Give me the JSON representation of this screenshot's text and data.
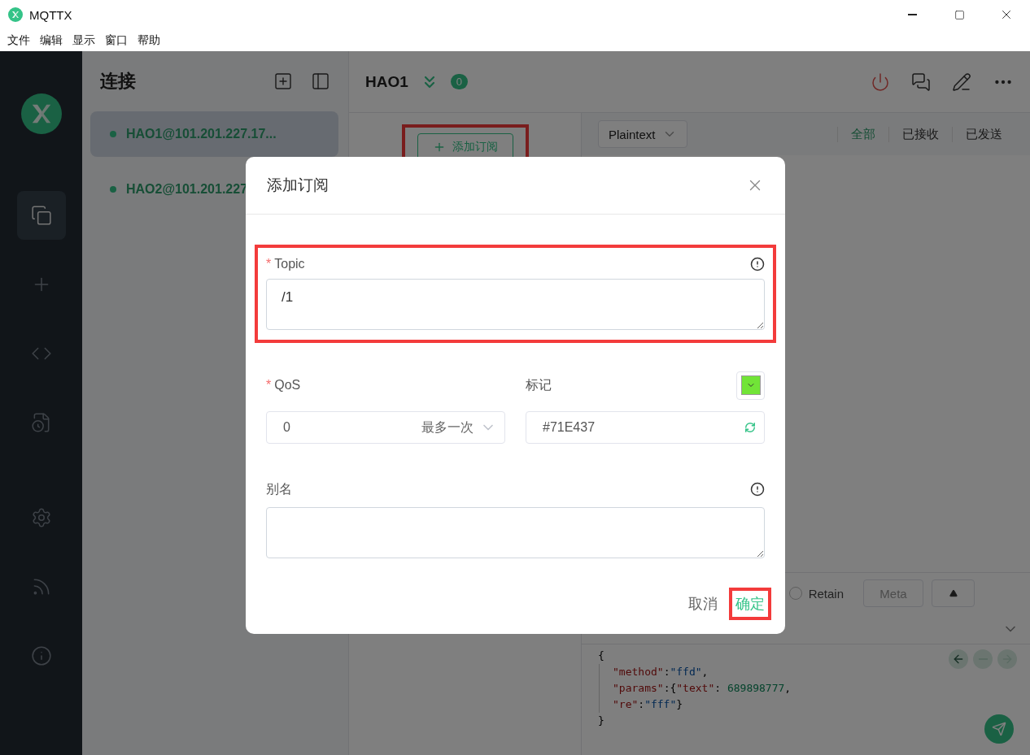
{
  "window": {
    "title": "MQTTX"
  },
  "menu": [
    "文件",
    "编辑",
    "显示",
    "窗口",
    "帮助"
  ],
  "nav": [
    {
      "kind": "connections",
      "selected": true
    },
    {
      "kind": "new",
      "selected": false
    },
    {
      "kind": "script",
      "selected": false
    },
    {
      "kind": "log",
      "selected": false
    },
    {
      "kind": "settings",
      "selected": false
    },
    {
      "kind": "feed",
      "selected": false
    },
    {
      "kind": "about",
      "selected": false
    }
  ],
  "connections": {
    "title": "连接",
    "items": [
      {
        "name": "HAO1@101.201.227.17...",
        "selected": true
      },
      {
        "name": "HAO2@101.201.227",
        "selected": false
      }
    ]
  },
  "header": {
    "title": "HAO1",
    "badge": "0"
  },
  "add_subscription": {
    "label": "添加订阅"
  },
  "format": {
    "value": "Plaintext"
  },
  "filter_tabs": [
    {
      "label": "全部",
      "selected": true
    },
    {
      "label": "已接收",
      "selected": false
    },
    {
      "label": "已发送",
      "selected": false
    }
  ],
  "composer": {
    "retain": {
      "label": "Retain",
      "checked": false
    },
    "meta": "Meta",
    "code_lines": [
      {
        "indented": false,
        "tokens": [
          {
            "kind": "punct",
            "text": "{"
          }
        ]
      },
      {
        "indented": true,
        "tokens": [
          {
            "kind": "key",
            "text": "\"method\""
          },
          {
            "kind": "punct",
            "text": ":"
          },
          {
            "kind": "string",
            "text": "\"ffd\""
          },
          {
            "kind": "punct",
            "text": ","
          }
        ]
      },
      {
        "indented": true,
        "tokens": [
          {
            "kind": "key",
            "text": "\"params\""
          },
          {
            "kind": "punct",
            "text": ":{"
          },
          {
            "kind": "key",
            "text": "\"text\""
          },
          {
            "kind": "punct",
            "text": ": "
          },
          {
            "kind": "number",
            "text": "689898777"
          },
          {
            "kind": "punct",
            "text": ","
          }
        ]
      },
      {
        "indented": true,
        "tokens": [
          {
            "kind": "key",
            "text": "\"re\""
          },
          {
            "kind": "punct",
            "text": ":"
          },
          {
            "kind": "string",
            "text": "\"fff\""
          },
          {
            "kind": "punct",
            "text": "}"
          }
        ]
      },
      {
        "indented": false,
        "tokens": [
          {
            "kind": "punct",
            "text": "}"
          }
        ]
      }
    ]
  },
  "dialog": {
    "title": "添加订阅",
    "topic": {
      "marker": "*",
      "label": "Topic",
      "value": "/1"
    },
    "qos": {
      "marker": "*",
      "label": "QoS",
      "value": "0",
      "description": "最多一次"
    },
    "mark": {
      "label": "标记",
      "value": "#71E437",
      "color": "#71e437"
    },
    "alias": {
      "label": "别名"
    },
    "buttons": {
      "cancel": "取消",
      "confirm": "确定"
    }
  }
}
